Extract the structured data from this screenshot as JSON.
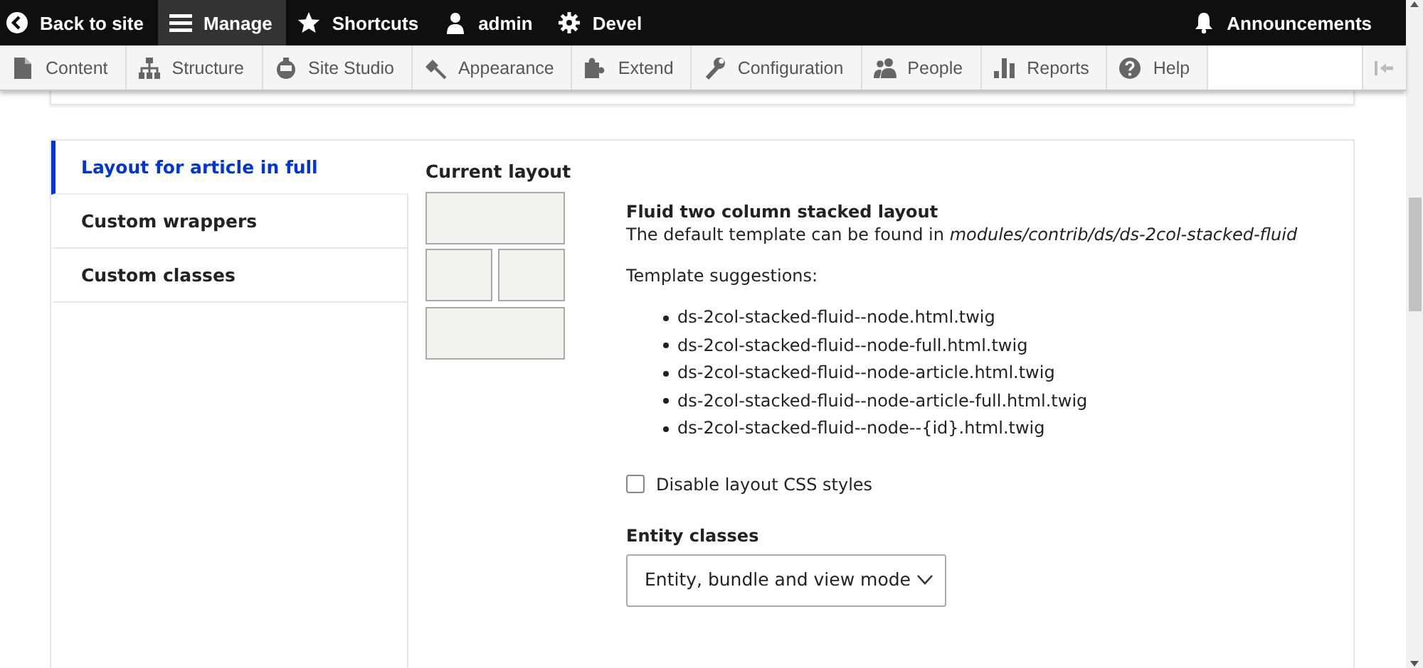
{
  "toolbar": {
    "items": [
      {
        "label": "Back to site",
        "selected": false
      },
      {
        "label": "Manage",
        "selected": true
      },
      {
        "label": "Shortcuts",
        "selected": false
      },
      {
        "label": "admin",
        "selected": false
      },
      {
        "label": "Devel",
        "selected": false
      }
    ],
    "announcements": "Announcements"
  },
  "admin_menu": [
    {
      "label": "Content"
    },
    {
      "label": "Structure"
    },
    {
      "label": "Site Studio"
    },
    {
      "label": "Appearance"
    },
    {
      "label": "Extend"
    },
    {
      "label": "Configuration"
    },
    {
      "label": "People"
    },
    {
      "label": "Reports"
    },
    {
      "label": "Help"
    }
  ],
  "vertical_tabs": [
    {
      "label": "Layout for article in full",
      "selected": true
    },
    {
      "label": "Custom wrappers",
      "selected": false
    },
    {
      "label": "Custom classes",
      "selected": false
    }
  ],
  "current_layout": {
    "heading": "Current layout",
    "title": "Fluid two column stacked layout",
    "description": "The default template can be found in *modules/contrib/ds/ds-2col-stacked-fluid*",
    "suggestions_label": "Template suggestions:",
    "suggestions": [
      "ds-2col-stacked-fluid--node.html.twig",
      "ds-2col-stacked-fluid--node-full.html.twig",
      "ds-2col-stacked-fluid--node-article.html.twig",
      "ds-2col-stacked-fluid--node-article-full.html.twig",
      "ds-2col-stacked-fluid--node--{id}.html.twig"
    ]
  },
  "disable_css": {
    "label": "Disable layout CSS styles",
    "checked": false
  },
  "entity_classes": {
    "label": "Entity classes",
    "value": "Entity, bundle and view mode"
  }
}
